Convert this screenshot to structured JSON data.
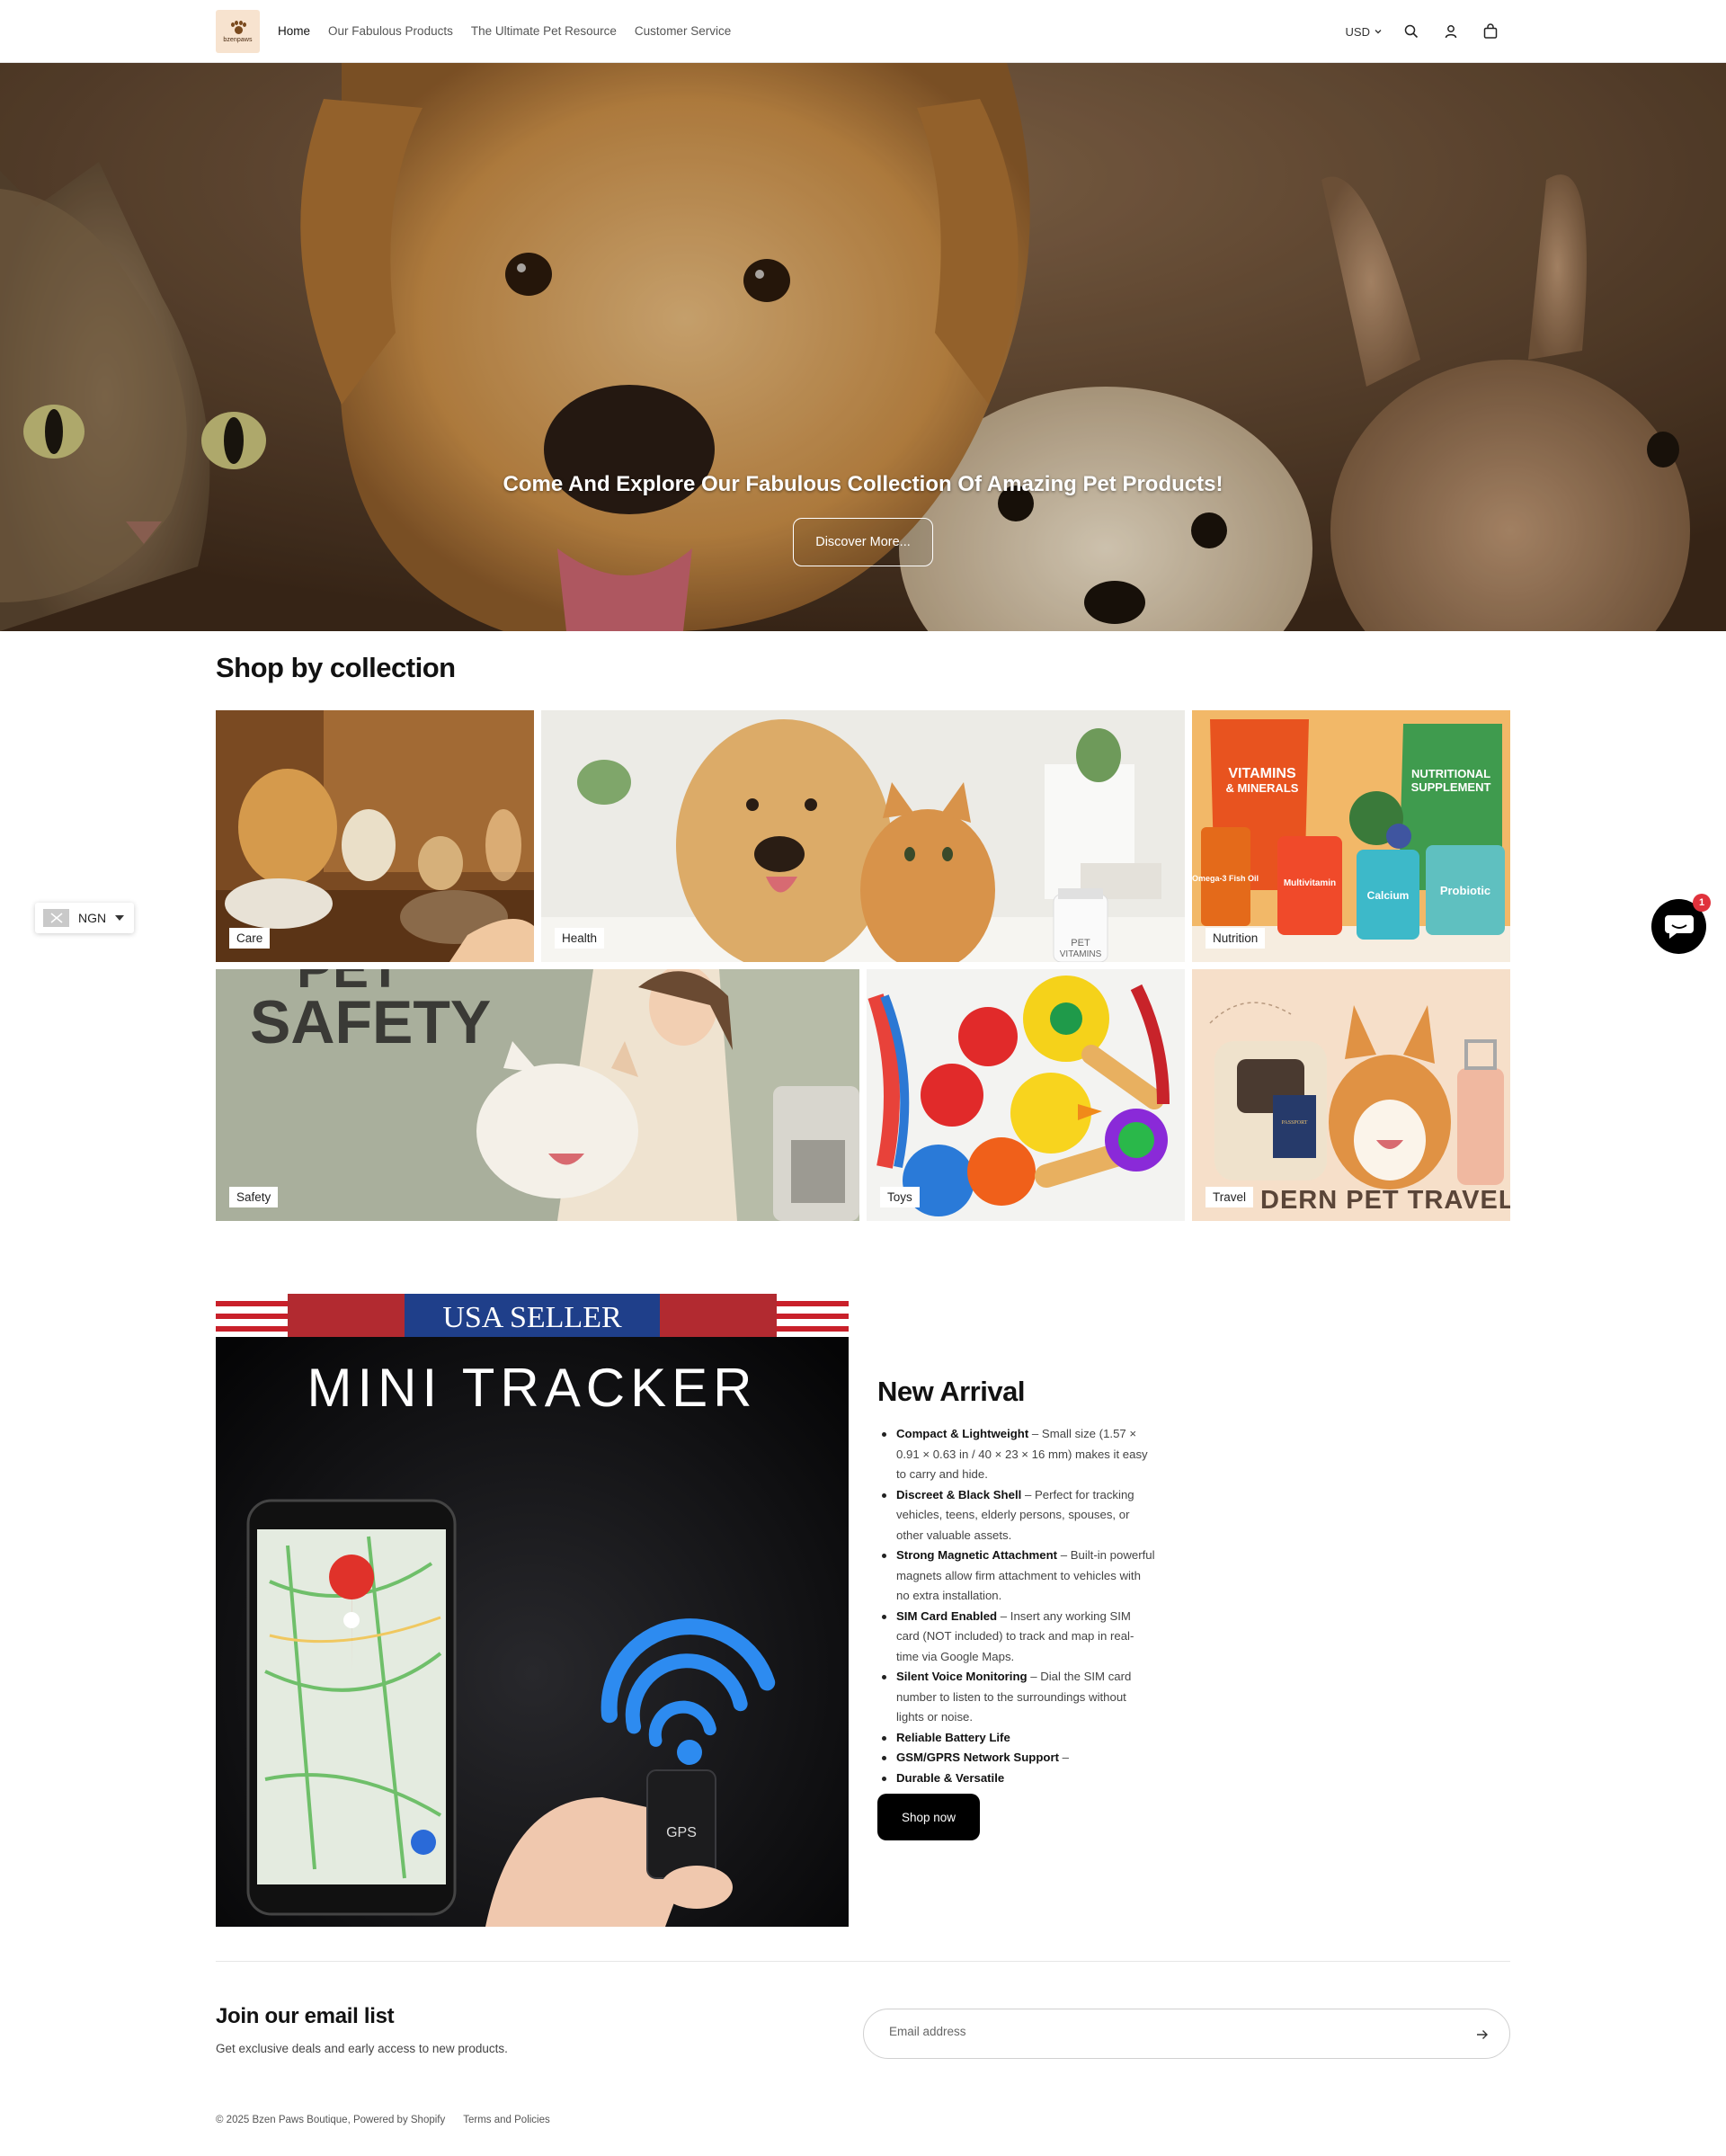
{
  "header": {
    "logo_text": "bzenpaws",
    "nav": [
      "Home",
      "Our Fabulous Products",
      "The Ultimate Pet Resource",
      "Customer Service"
    ],
    "currency": "USD"
  },
  "hero": {
    "heading": "Come And Explore Our Fabulous Collection Of Amazing Pet Products!",
    "button": "Discover More..."
  },
  "collections": {
    "title": "Shop by collection",
    "items": [
      "Care",
      "Health",
      "Nutrition",
      "Safety",
      "Toys",
      "Travel"
    ],
    "image_text": {
      "health_bottle": [
        "PET",
        "VITAMINS"
      ],
      "nutrition_bags": [
        "VITAMINS",
        "& MINERALS",
        "NUTRITIONAL",
        "SUPPLEMENT"
      ],
      "nutrition_jars": [
        "Omega-3 Fish Oil",
        "Multivitamin",
        "Calcium",
        "Probiotic"
      ],
      "safety_headline": [
        "PET",
        "SAFETY"
      ],
      "travel_banner": "DERN PET TRAVEL",
      "travel_passport": "PASSPORT"
    }
  },
  "new_arrival": {
    "image_banner": "USA SELLER",
    "image_title": "MINI TRACKER",
    "image_device_label": "GPS",
    "title": "New Arrival",
    "features": [
      {
        "bold": "Compact & Lightweight",
        "text": " – Small size (1.57 × 0.91 × 0.63 in / 40 × 23 × 16 mm) makes it easy to carry and hide."
      },
      {
        "bold": "Discreet & Black Shell",
        "text": " – Perfect for tracking vehicles, teens, elderly persons, spouses, or other valuable assets."
      },
      {
        "bold": "Strong Magnetic Attachment",
        "text": " – Built-in powerful magnets allow firm attachment to vehicles with no extra installation."
      },
      {
        "bold": "SIM Card Enabled",
        "text": " – Insert any working SIM card (NOT included) to track and map in real-time via Google Maps."
      },
      {
        "bold": "Silent Voice Monitoring",
        "text": " – Dial the SIM card number to listen to the surroundings without lights or noise."
      },
      {
        "bold": "Reliable Battery Life",
        "text": ""
      },
      {
        "bold": "GSM/GPRS Network Support",
        "text": " –"
      },
      {
        "bold": "Durable & Versatile",
        "text": ""
      }
    ],
    "button": "Shop now"
  },
  "newsletter": {
    "title": "Join our email list",
    "subtitle": "Get exclusive deals and early access to new products.",
    "placeholder": "Email address"
  },
  "footer": {
    "copyright": "© 2025 Bzen Paws Boutique, Powered by Shopify",
    "terms": "Terms and Policies"
  },
  "currency_widget": {
    "label": "NGN"
  },
  "chat": {
    "badge": "1"
  }
}
